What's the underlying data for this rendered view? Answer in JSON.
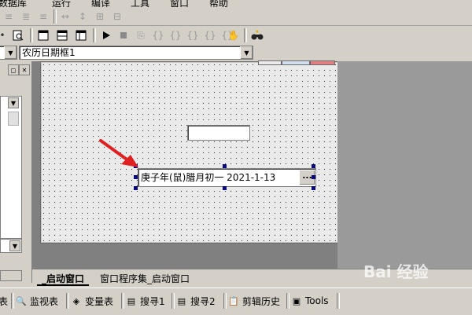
{
  "menu": [
    "数据库",
    "运行",
    "编译",
    "工具",
    "窗口",
    "帮助"
  ],
  "toolbar_top_icons": [
    "align-left-icon",
    "align-center-icon",
    "align-right-icon",
    "equal-width-icon",
    "equal-height-icon",
    "same-size-icon",
    "space-icon"
  ],
  "toolbar_icons": [
    "preview-icon",
    "tab-view-icon",
    "split-view-icon",
    "table-view-icon",
    "run-icon",
    "stop-icon",
    "step-icon",
    "step-into-icon",
    "step-over-icon",
    "step-out-icon",
    "run-to-cursor-icon",
    "hand-icon",
    "find-icon"
  ],
  "combo": {
    "left_value": "",
    "control_value": "农历日期框1"
  },
  "form": {
    "date_control_text": "庚子年(鼠)腊月初一  2021-1-13",
    "date_button": "..."
  },
  "tabs": [
    "_启动窗口",
    "窗口程序集_启动窗口"
  ],
  "bottom_tabs": [
    {
      "label": "表",
      "icon": "table-icon"
    },
    {
      "label": "监视表",
      "icon": "search-icon"
    },
    {
      "label": "变量表",
      "icon": "variables-icon"
    },
    {
      "label": "搜寻1",
      "icon": "search-list-icon"
    },
    {
      "label": "搜寻2",
      "icon": "search-list-icon"
    },
    {
      "label": "剪辑历史",
      "icon": "clipboard-icon"
    },
    {
      "label": "Tools",
      "icon": "tools-icon"
    }
  ],
  "watermark": "Bai 经验",
  "colors": {
    "chrome": "#d4d0c8",
    "workspace": "#808080",
    "selection_handle": "#0a0a80",
    "arrow": "#e02020"
  }
}
